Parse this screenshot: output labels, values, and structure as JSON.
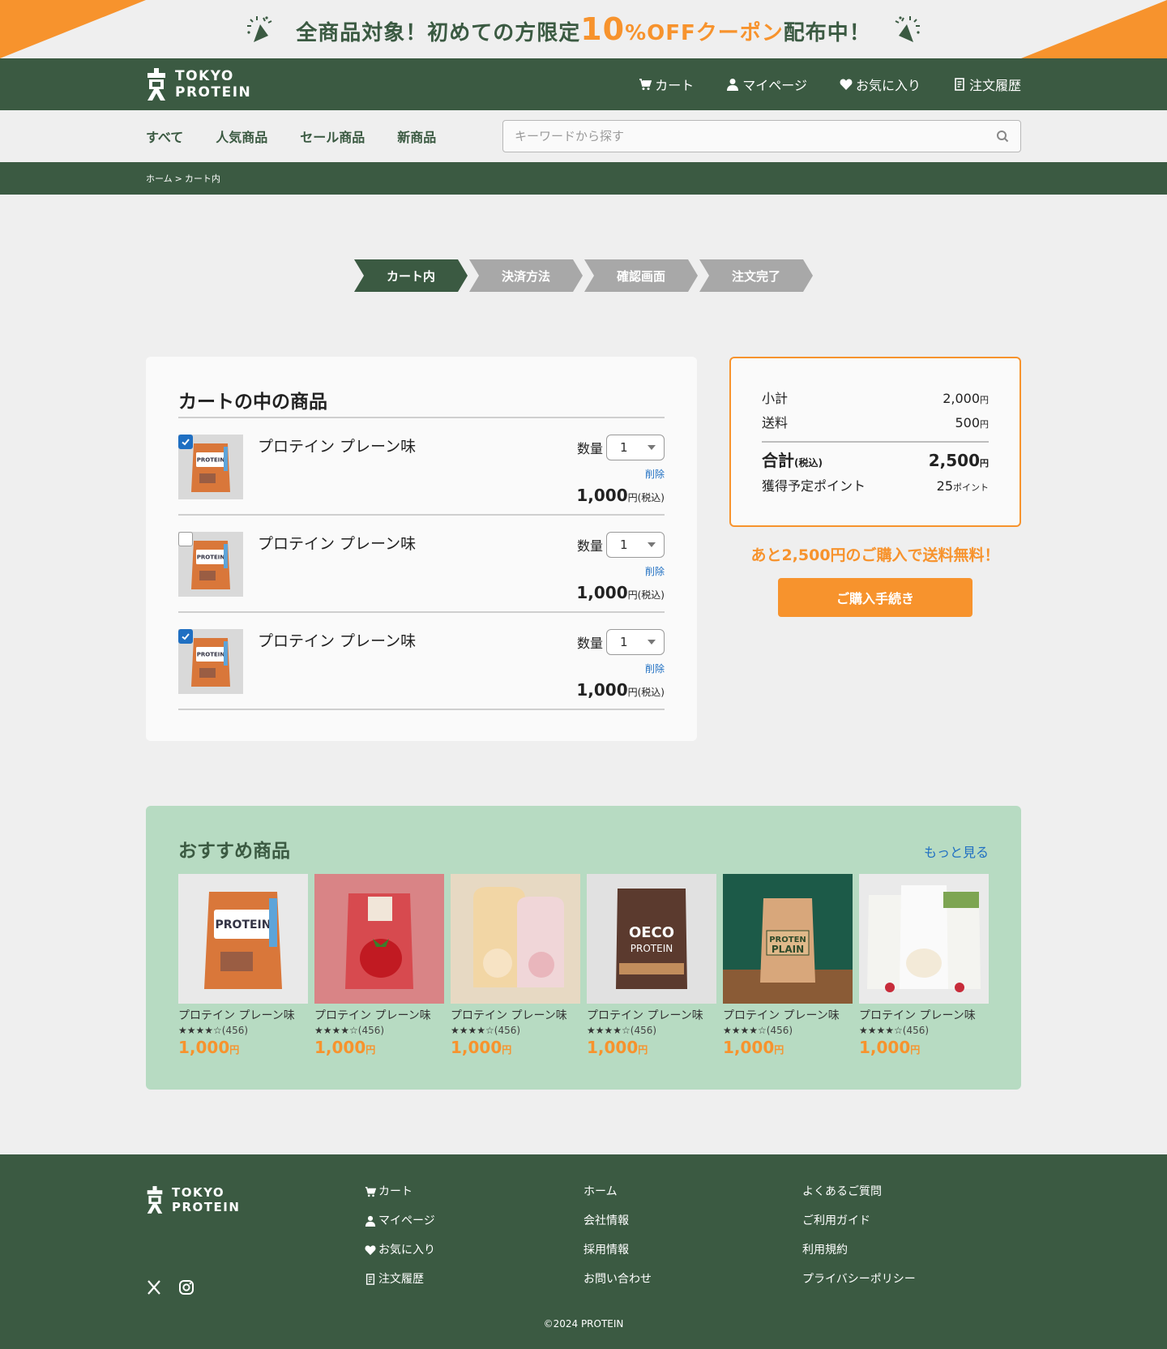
{
  "banner": {
    "text_pre": "全商品対象！初めての方限定",
    "text_num": "10",
    "text_off": "%OFFクーポン",
    "text_post": "配布中！"
  },
  "brand": {
    "line1": "TOKYO",
    "line2": "PROTEIN"
  },
  "header_nav": [
    {
      "label": "カート",
      "icon": "cart-icon"
    },
    {
      "label": "マイページ",
      "icon": "user-icon"
    },
    {
      "label": "お気に入り",
      "icon": "heart-icon"
    },
    {
      "label": "注文履歴",
      "icon": "receipt-icon"
    }
  ],
  "categories": [
    "すべて",
    "人気商品",
    "セール商品",
    "新商品"
  ],
  "search": {
    "placeholder": "キーワードから探す"
  },
  "breadcrumb": {
    "home": "ホーム",
    "sep": ">",
    "current": "カート内"
  },
  "steps": [
    {
      "label": "カート内",
      "active": true
    },
    {
      "label": "決済方法",
      "active": false
    },
    {
      "label": "確認画面",
      "active": false
    },
    {
      "label": "注文完了",
      "active": false
    }
  ],
  "cart": {
    "title": "カートの中の商品",
    "qty_label": "数量",
    "delete_label": "削除",
    "tax_label": "円(税込)",
    "items": [
      {
        "name": "プロテイン プレーン味",
        "qty": "1",
        "price": "1,000",
        "checked": true
      },
      {
        "name": "プロテイン プレーン味",
        "qty": "1",
        "price": "1,000",
        "checked": false
      },
      {
        "name": "プロテイン プレーン味",
        "qty": "1",
        "price": "1,000",
        "checked": true
      }
    ]
  },
  "summary": {
    "subtotal_label": "小計",
    "subtotal_value": "2,000",
    "yen": "円",
    "shipping_label": "送料",
    "shipping_value": "500",
    "total_label": "合計",
    "total_tax": "(税込)",
    "total_value": "2,500",
    "points_label": "獲得予定ポイント",
    "points_value": "25",
    "points_unit": "ポイント",
    "free_shipping_msg": "あと2,500円のご購入で送料無料！",
    "checkout_label": "ご購入手続き"
  },
  "recommend": {
    "title": "おすすめ商品",
    "more_label": "もっと見る",
    "products": [
      {
        "name": "プロテイン プレーン味",
        "stars": "★★★★☆",
        "count": "(456)",
        "price": "1,000",
        "yen": "円",
        "art": "orange-bag"
      },
      {
        "name": "プロテイン プレーン味",
        "stars": "★★★★☆",
        "count": "(456)",
        "price": "1,000",
        "yen": "円",
        "art": "strawberry-bag"
      },
      {
        "name": "プロテイン プレーン味",
        "stars": "★★★★☆",
        "count": "(456)",
        "price": "1,000",
        "yen": "円",
        "art": "bottles"
      },
      {
        "name": "プロテイン プレーン味",
        "stars": "★★★★☆",
        "count": "(456)",
        "price": "1,000",
        "yen": "円",
        "art": "chocolate-bag"
      },
      {
        "name": "プロテイン プレーン味",
        "stars": "★★★★☆",
        "count": "(456)",
        "price": "1,000",
        "yen": "円",
        "art": "plain-bag"
      },
      {
        "name": "プロテイン プレーン味",
        "stars": "★★★★☆",
        "count": "(456)",
        "price": "1,000",
        "yen": "円",
        "art": "package-set"
      }
    ]
  },
  "footer": {
    "col1": [
      {
        "label": "カート",
        "icon": "cart-icon"
      },
      {
        "label": "マイページ",
        "icon": "user-icon"
      },
      {
        "label": "お気に入り",
        "icon": "heart-icon"
      },
      {
        "label": "注文履歴",
        "icon": "receipt-icon"
      }
    ],
    "col2": [
      "ホーム",
      "会社情報",
      "採用情報",
      "お問い合わせ"
    ],
    "col3": [
      "よくあるご質問",
      "ご利用ガイド",
      "利用規約",
      "プライバシーポリシー"
    ],
    "copyright": "©2024 PROTEIN"
  },
  "colors": {
    "green": "#3b5a42",
    "orange": "#f7932d",
    "mint": "#b7dbc2",
    "link": "#1f6fc2"
  }
}
